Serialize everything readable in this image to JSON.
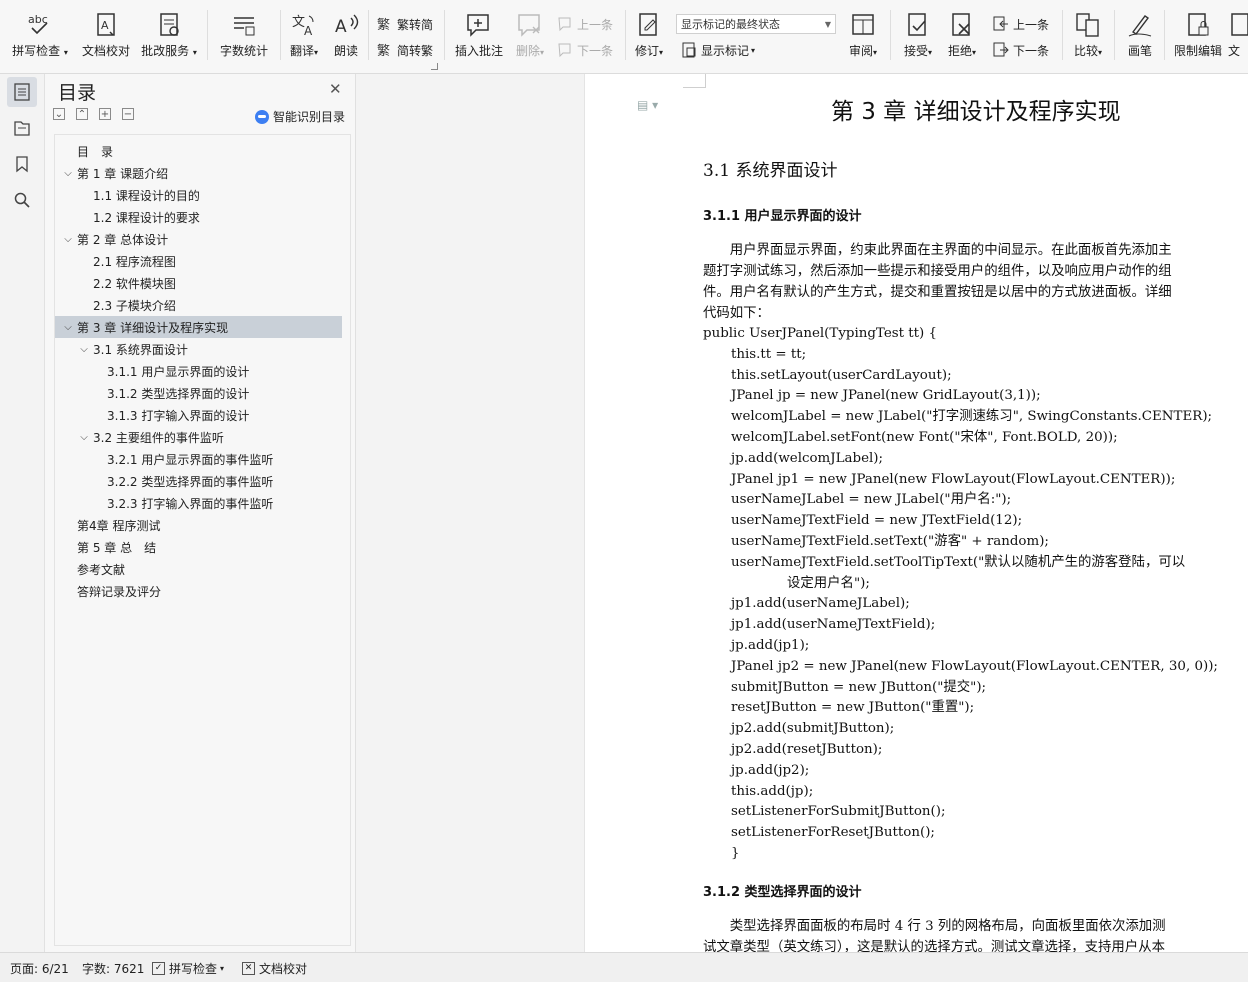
{
  "ribbon": {
    "buttons": [
      {
        "label": "拼写检查",
        "dropdown": true,
        "icon": "spellcheck-icon"
      },
      {
        "label": "文档校对",
        "dropdown": false,
        "icon": "proofread-icon"
      },
      {
        "label": "批改服务",
        "dropdown": true,
        "icon": "correction-service-icon"
      },
      {
        "label": "字数统计",
        "dropdown": false,
        "icon": "word-count-icon"
      },
      {
        "label": "翻译",
        "dropdown": true,
        "icon": "translate-icon"
      },
      {
        "label": "朗读",
        "dropdown": false,
        "icon": "read-aloud-icon"
      }
    ],
    "trad_to_simp": "繁转简",
    "simp_to_trad": "简转繁",
    "insert_comment": "插入批注",
    "delete_comment": "删除",
    "prev_comment": "上一条",
    "next_comment": "下一条",
    "track_changes": "修订",
    "markup_mode": "显示标记的最终状态",
    "show_markup": "显示标记",
    "review": "审阅",
    "accept": "接受",
    "reject": "拒绝",
    "prev_change": "上一条",
    "next_change": "下一条",
    "compare": "比较",
    "ink": "画笔",
    "restrict_edit": "限制编辑",
    "doc_cut": "文"
  },
  "toc": {
    "title": "目录",
    "smart_label": "智能识别目录",
    "items": [
      {
        "text": "目　录",
        "level": 0,
        "chev": ""
      },
      {
        "text": "第 1 章  课题介绍",
        "level": 0,
        "chev": "v"
      },
      {
        "text": "1.1  课程设计的目的",
        "level": 1,
        "chev": ""
      },
      {
        "text": "1.2  课程设计的要求",
        "level": 1,
        "chev": ""
      },
      {
        "text": "第 2 章  总体设计",
        "level": 0,
        "chev": "v"
      },
      {
        "text": "2.1  程序流程图",
        "level": 1,
        "chev": ""
      },
      {
        "text": "2.2  软件模块图",
        "level": 1,
        "chev": ""
      },
      {
        "text": "2.3  子模块介绍",
        "level": 1,
        "chev": ""
      },
      {
        "text": "第 3 章  详细设计及程序实现",
        "level": 0,
        "chev": "v",
        "selected": true
      },
      {
        "text": "3.1  系统界面设计",
        "level": 1,
        "chev": "v"
      },
      {
        "text": "3.1.1  用户显示界面的设计",
        "level": 2,
        "chev": ""
      },
      {
        "text": "3.1.2 类型选择界面的设计",
        "level": 2,
        "chev": ""
      },
      {
        "text": "3.1.3  打字输入界面的设计",
        "level": 2,
        "chev": ""
      },
      {
        "text": "3.2  主要组件的事件监听",
        "level": 1,
        "chev": "v"
      },
      {
        "text": "3.2.1  用户显示界面的事件监听",
        "level": 2,
        "chev": ""
      },
      {
        "text": "3.2.2  类型选择界面的事件监听",
        "level": 2,
        "chev": ""
      },
      {
        "text": "3.2.3  打字输入界面的事件监听",
        "level": 2,
        "chev": ""
      },
      {
        "text": "第4章  程序测试",
        "level": 0,
        "chev": ""
      },
      {
        "text": "第 5 章  总　结",
        "level": 0,
        "chev": ""
      },
      {
        "text": "参考文献",
        "level": 0,
        "chev": ""
      },
      {
        "text": "答辩记录及评分",
        "level": 0,
        "chev": ""
      }
    ]
  },
  "doc": {
    "chapter_title": "第 3 章  详细设计及程序实现",
    "section_title": "3.1  系统界面设计",
    "sub1_title": "3.1.1  用户显示界面的设计",
    "para1": [
      "　　用户界面显示界面，约束此界面在主界面的中间显示。在此面板首先添加主",
      "题打字测试练习，然后添加一些提示和接受用户的组件，以及响应用户动作的组",
      "件。用户名有默认的产生方式，提交和重置按钮是以居中的方式放进面板。详细",
      "代码如下："
    ],
    "code": [
      {
        "text": "public UserJPanel(TypingTest tt) {",
        "indent": 0
      },
      {
        "text": "this.tt = tt;",
        "indent": 1
      },
      {
        "text": "this.setLayout(userCardLayout);",
        "indent": 1
      },
      {
        "text": "JPanel jp = new JPanel(new GridLayout(3,1));",
        "indent": 1
      },
      {
        "text": "welcomJLabel = new JLabel(\"打字测速练习\", SwingConstants.CENTER);",
        "indent": 1
      },
      {
        "text": "welcomJLabel.setFont(new Font(\"宋体\", Font.BOLD, 20));",
        "indent": 1
      },
      {
        "text": "jp.add(welcomJLabel);",
        "indent": 1
      },
      {
        "text": "JPanel jp1 = new JPanel(new FlowLayout(FlowLayout.CENTER));",
        "indent": 1
      },
      {
        "text": "userNameJLabel = new JLabel(\"用户名:\");",
        "indent": 1
      },
      {
        "text": "userNameJTextField = new JTextField(12);",
        "indent": 1
      },
      {
        "text": "userNameJTextField.setText(\"游客\" + random);",
        "indent": 1
      },
      {
        "text": "userNameJTextField.setToolTipText(\"默认以随机产生的游客登陆，可以",
        "indent": 1
      },
      {
        "text": "设定用户名\");",
        "indent": 2
      },
      {
        "text": "jp1.add(userNameJLabel);",
        "indent": 1
      },
      {
        "text": "jp1.add(userNameJTextField);",
        "indent": 1
      },
      {
        "text": "jp.add(jp1);",
        "indent": 1
      },
      {
        "text": "JPanel jp2 = new JPanel(new FlowLayout(FlowLayout.CENTER, 30, 0));",
        "indent": 1
      },
      {
        "text": "submitJButton = new JButton(\"提交\");",
        "indent": 1
      },
      {
        "text": "resetJButton = new JButton(\"重置\");",
        "indent": 1
      },
      {
        "text": "jp2.add(submitJButton);",
        "indent": 1
      },
      {
        "text": "jp2.add(resetJButton);",
        "indent": 1
      },
      {
        "text": "jp.add(jp2);",
        "indent": 1
      },
      {
        "text": "this.add(jp);",
        "indent": 1
      },
      {
        "text": "setListenerForSubmitJButton();",
        "indent": 1
      },
      {
        "text": "setListenerForResetJButton();",
        "indent": 1
      },
      {
        "text": "}",
        "indent": 1
      }
    ],
    "sub2_title": "3.1.2 类型选择界面的设计",
    "para2": [
      "　　类型选择界面面板的布局时 4 行 3 列的网格布局，向面板里面依次添加测",
      "试文章类型（英文练习），这是默认的选择方式。测试文章选择，支持用户从本"
    ]
  },
  "status": {
    "page": "页面: 6/21",
    "words": "字数: 7621",
    "spell": "拼写检查",
    "proof": "文档校对"
  }
}
